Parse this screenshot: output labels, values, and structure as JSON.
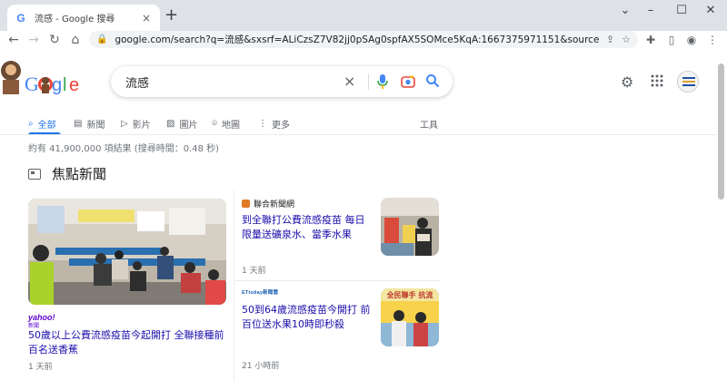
{
  "browser": {
    "tab_title": "流感 - Google 搜尋",
    "tab_favicon": "G",
    "tab_close": "×",
    "new_tab": "+",
    "url": "google.com/search?q=流感&sxsrf=ALiCzsZ7V82jj0pSAg0spfAX5SOMce5KqA:1667375971151&source=lnms&sa=..."
  },
  "search": {
    "query": "流感",
    "clear": "×",
    "logo_text": "Google"
  },
  "tabs": [
    {
      "icon": "search-icon",
      "glyph": "⌕",
      "label": "全部"
    },
    {
      "icon": "news-icon",
      "glyph": "▤",
      "label": "新聞"
    },
    {
      "icon": "video-icon",
      "glyph": "▷",
      "label": "影片"
    },
    {
      "icon": "image-icon",
      "glyph": "▨",
      "label": "圖片"
    },
    {
      "icon": "map-pin-icon",
      "glyph": "⌾",
      "label": "地圖"
    },
    {
      "icon": "more-icon",
      "glyph": "⋮",
      "label": "更多"
    }
  ],
  "tools_label": "工具",
  "result_stats": "約有 41,900,000 項結果 (搜尋時間：0.48 秒)",
  "section_title": "焦點新聞",
  "news": {
    "main": {
      "source": "yahoo!",
      "source_sub": "新聞",
      "headline": "50歲以上公費流感疫苗今起開打 全聯接種前百名送香蕉",
      "time": "1 天前"
    },
    "side": [
      {
        "source": "聯合新聞網",
        "headline": "到全聯打公費流感疫苗 每日限量送礦泉水、當季水果",
        "time": "1 天前"
      },
      {
        "source": "ETtoday新聞雲",
        "headline": "50到64歲流感疫苗今開打 前百位送水果10時即秒殺",
        "time": "21 小時前",
        "thumb_caption": "全民聯手 抗流"
      }
    ]
  },
  "colors": {
    "link": "#1a0dab",
    "accent": "#1a73e8",
    "muted": "#70757a"
  }
}
